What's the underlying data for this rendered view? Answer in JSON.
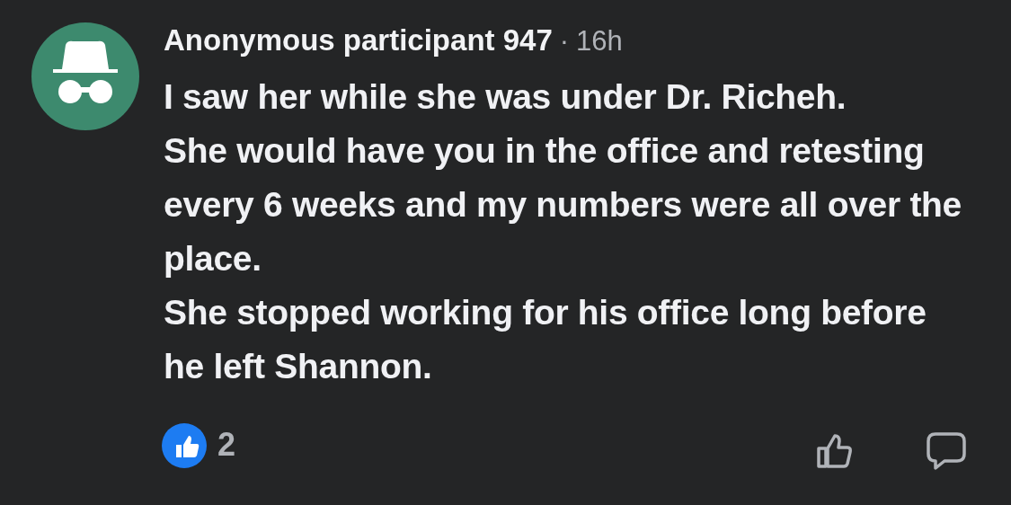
{
  "comment": {
    "author": "Anonymous participant 947",
    "separator": "·",
    "time": "16h",
    "paragraphs": [
      "I saw her while she was under Dr. Richeh.",
      "She would have you in the office and retesting every 6 weeks and my numbers were all over the place.",
      "She stopped working for his office long before he left Shannon."
    ],
    "reaction_count": "2"
  }
}
